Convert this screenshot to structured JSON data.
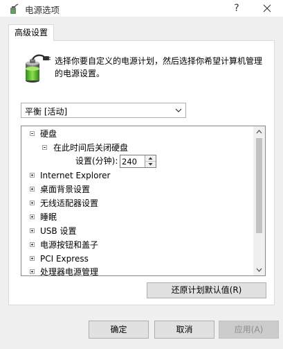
{
  "window": {
    "title": "电源选项",
    "help_label": "?"
  },
  "tabs": [
    {
      "label": "高级设置"
    }
  ],
  "panel": {
    "description": "选择你要自定义的电源计划，然后选择你希望计算机管理的电源设置。",
    "plan_select": {
      "value": "平衡 [活动]"
    },
    "tree": {
      "hard_disk": "硬盘",
      "turn_off_after": "在此时间后关闭硬盘",
      "minutes_label": "设置(分钟):",
      "minutes_value": "240",
      "items": [
        "Internet Explorer",
        "桌面背景设置",
        "无线适配器设置",
        "睡眠",
        "USB 设置",
        "电源按钮和盖子",
        "PCI Express",
        "处理器电源管理"
      ]
    },
    "restore_label": "还原计划默认值(R)"
  },
  "buttons": {
    "ok": "确定",
    "cancel": "取消",
    "apply": "应用(A)"
  },
  "colors": {
    "window_bg": "#f0f0f0",
    "panel_bg": "#ffffff",
    "disabled_text": "#8c8c8c"
  }
}
